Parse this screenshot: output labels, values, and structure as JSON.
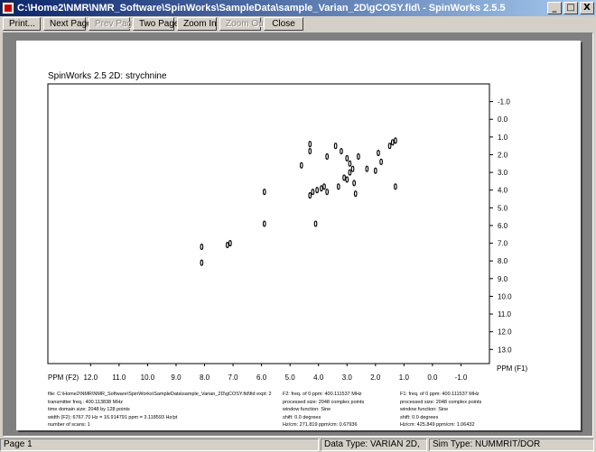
{
  "window": {
    "title": "C:\\Home2\\NMR\\NMR_Software\\SpinWorks\\SampleData\\sample_Varian_2D\\gCOSY.fid\\ - SpinWorks 2.5.5",
    "controls": [
      "_",
      "□",
      "X"
    ]
  },
  "toolbar": [
    {
      "label": "Print...",
      "enabled": true
    },
    {
      "label": "Next Page",
      "enabled": true
    },
    {
      "label": "Prev Page",
      "enabled": false
    },
    {
      "label": "Two Page",
      "enabled": true
    },
    {
      "label": "Zoom In",
      "enabled": true
    },
    {
      "label": "Zoom Out",
      "enabled": false
    },
    {
      "label": "Close",
      "enabled": true
    }
  ],
  "plot": {
    "title": "SpinWorks 2.5 2D:  strychnine",
    "x_axis_label": "PPM (F2)",
    "y_axis_label": "PPM (F1)"
  },
  "chart_data": {
    "type": "scatter",
    "x_ticks": [
      "12.0",
      "11.0",
      "10.0",
      "9.0",
      "8.0",
      "7.0",
      "6.0",
      "5.0",
      "4.0",
      "3.0",
      "2.0",
      "1.0",
      "0.0",
      "-1.0"
    ],
    "y_ticks": [
      "-1.0",
      "0.0",
      "1.0",
      "2.0",
      "3.0",
      "4.0",
      "5.0",
      "6.0",
      "7.0",
      "8.0",
      "9.0",
      "10.0",
      "11.0",
      "12.0",
      "13.0"
    ],
    "xlim": [
      13.5,
      -2.0
    ],
    "ylim": [
      -2.0,
      13.8
    ],
    "peaks": [
      [
        8.1,
        7.2
      ],
      [
        8.1,
        8.1
      ],
      [
        7.2,
        7.1
      ],
      [
        7.1,
        7.0
      ],
      [
        5.9,
        4.1
      ],
      [
        5.9,
        5.9
      ],
      [
        4.3,
        4.3
      ],
      [
        4.2,
        4.1
      ],
      [
        4.1,
        5.9
      ],
      [
        4.05,
        4.0
      ],
      [
        3.9,
        3.9
      ],
      [
        3.8,
        3.8
      ],
      [
        3.7,
        4.1
      ],
      [
        3.7,
        2.1
      ],
      [
        3.4,
        1.5
      ],
      [
        3.3,
        3.8
      ],
      [
        3.2,
        1.8
      ],
      [
        3.1,
        3.3
      ],
      [
        3.0,
        2.2
      ],
      [
        2.9,
        3.0
      ],
      [
        2.8,
        2.8
      ],
      [
        2.75,
        3.6
      ],
      [
        2.7,
        4.2
      ],
      [
        2.6,
        2.1
      ],
      [
        2.3,
        2.8
      ],
      [
        2.0,
        2.9
      ],
      [
        1.9,
        1.9
      ],
      [
        1.8,
        2.4
      ],
      [
        1.5,
        1.5
      ],
      [
        1.4,
        1.3
      ],
      [
        1.3,
        3.8
      ],
      [
        1.3,
        1.2
      ],
      [
        4.3,
        1.4
      ],
      [
        4.3,
        1.8
      ],
      [
        4.6,
        2.6
      ],
      [
        2.9,
        2.5
      ],
      [
        3.0,
        3.4
      ]
    ]
  },
  "info": {
    "col1": [
      "file: C:\\Home2\\NMR\\NMR_Software\\SpinWorks\\SampleData\\sample_Varian_2D\\gCOSY.fid\\fid  expt: 2",
      "transmitter freq.: 400.113838 MHz",
      "time domain size: 2048 by 128 points",
      "width (F2): 6767.70 Hz = 16.914791 ppm = 3.118593 Hz/pt",
      "number of scans: 1"
    ],
    "col2": [
      "F2: freq. of 0 ppm: 400.111537 MHz",
      "processed size: 2048 complex points",
      "window function: Sine",
      "shift: 0.0 degrees",
      "Hz/cm: 271.819   ppm/cm: 0.67936"
    ],
    "col3": [
      "F1: freq. of 0 ppm: 400.111537 MHz",
      "processed size: 2048 complex points",
      "window function: Sine",
      "shift: 0.0 degrees",
      "Hz/cm: 425.849   ppm/cm: 1.06432"
    ]
  },
  "status": {
    "page": "Page 1",
    "data_type": "Data Type: VARIAN 2D,",
    "sim_type": "Sim Type: NUMMRIT/DOR"
  }
}
